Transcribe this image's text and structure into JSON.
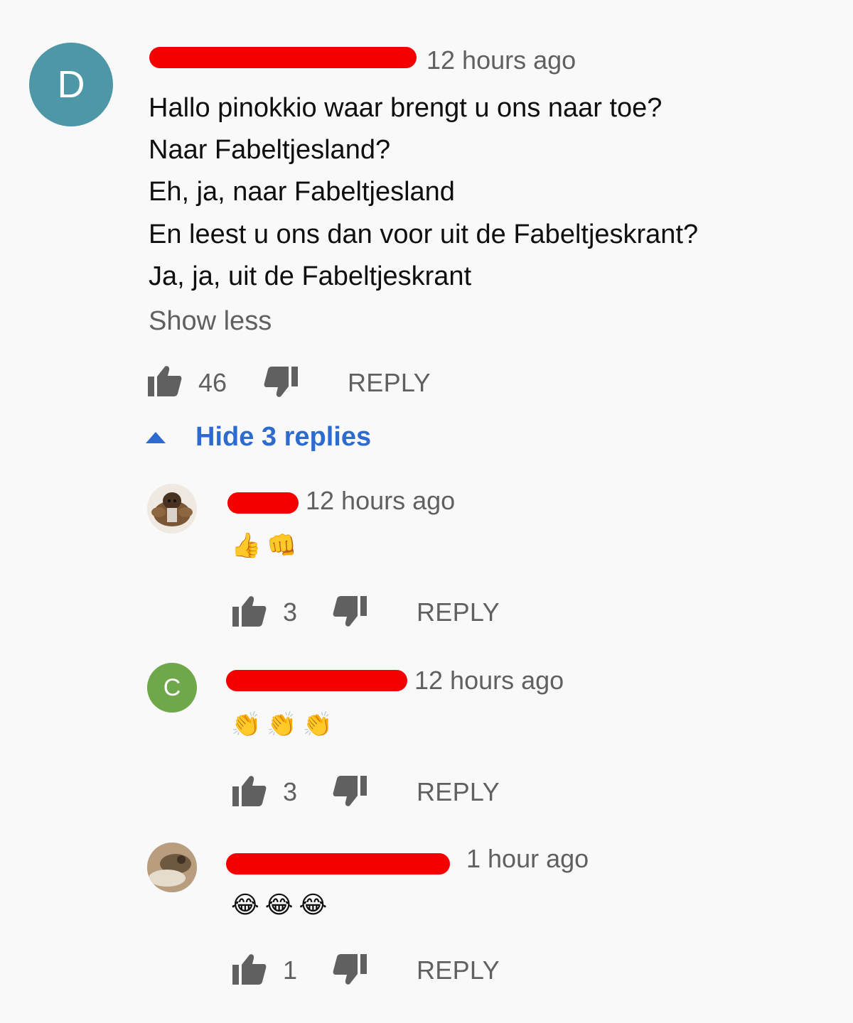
{
  "main_comment": {
    "avatar_letter": "D",
    "avatar_color": "#4d97a6",
    "timestamp": "12 hours ago",
    "lines": [
      "Hallo pinokkio waar brengt u ons naar toe?",
      "Naar Fabeltjesland?",
      "Eh, ja, naar Fabeltjesland",
      "En leest u ons dan voor uit de Fabeltjeskrant?",
      "Ja, ja, uit de Fabeltjeskrant"
    ],
    "show_less": "Show less",
    "likes": "46",
    "reply_label": "REPLY",
    "hide_replies": "Hide 3 replies"
  },
  "replies": [
    {
      "timestamp": "12 hours ago",
      "text": "👍👊",
      "likes": "3",
      "reply_label": "REPLY"
    },
    {
      "avatar_letter": "C",
      "avatar_color": "#6fa84a",
      "timestamp": "12 hours ago",
      "text": "👏👏👏",
      "likes": "3",
      "reply_label": "REPLY"
    },
    {
      "timestamp": "1 hour ago",
      "text": "😂😂😂",
      "likes": "1",
      "reply_label": "REPLY"
    }
  ],
  "colors": {
    "background": "#f9f9f9",
    "link_blue": "#2e6bd0",
    "secondary_text": "#606060",
    "redaction": "#f40000"
  }
}
